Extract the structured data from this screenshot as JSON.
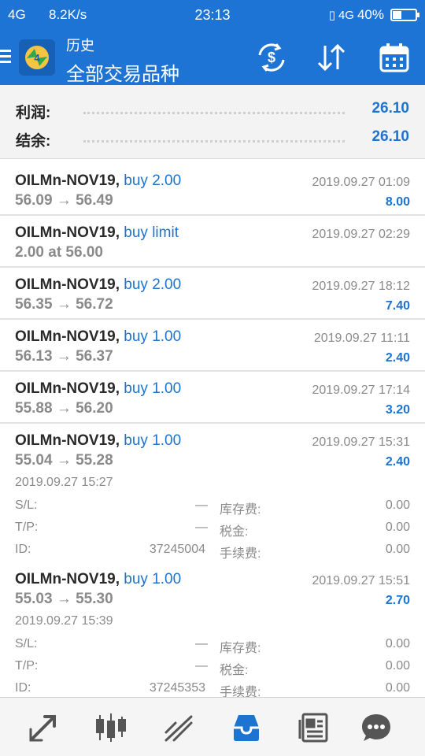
{
  "status_bar": {
    "network": "4G",
    "speed": "8.2K/s",
    "time": "23:13",
    "network2": "4G",
    "battery": "40%",
    "battery_level": 0.4
  },
  "header": {
    "subtitle": "历史",
    "title": "全部交易品种"
  },
  "summary": {
    "profit_label": "利润:",
    "profit_value": "26.10",
    "balance_label": "结余:",
    "balance_value": "26.10"
  },
  "deals": [
    {
      "symbol": "OILMn-NOV19,",
      "type": "buy 2.00",
      "prices": "56.09 → 56.49",
      "time": "2019.09.27 01:09",
      "profit": "8.00"
    },
    {
      "symbol": "OILMn-NOV19,",
      "type": "buy limit",
      "prices": "2.00 at 56.00",
      "time": "2019.09.27 02:29",
      "profit": ""
    },
    {
      "symbol": "OILMn-NOV19,",
      "type": "buy 2.00",
      "prices": "56.35 → 56.72",
      "time": "2019.09.27 18:12",
      "profit": "7.40"
    },
    {
      "symbol": "OILMn-NOV19,",
      "type": "buy 1.00",
      "prices": "56.13 → 56.37",
      "time": "2019.09.27 11:11",
      "profit": "2.40"
    },
    {
      "symbol": "OILMn-NOV19,",
      "type": "buy 1.00",
      "prices": "55.88 → 56.20",
      "time": "2019.09.27 17:14",
      "profit": "3.20"
    },
    {
      "symbol": "OILMn-NOV19,",
      "type": "buy 1.00",
      "prices": "55.04 → 55.28",
      "time": "2019.09.27 15:31",
      "profit": "2.40",
      "open_time": "2019.09.27 15:27",
      "sl_label": "S/L:",
      "sl": "—",
      "tp_label": "T/P:",
      "tp": "—",
      "id_label": "ID:",
      "id": "37245004",
      "swap_label": "库存费:",
      "swap": "0.00",
      "tax_label": "税金:",
      "tax": "0.00",
      "fee_label": "手续费:",
      "fee": "0.00"
    },
    {
      "symbol": "OILMn-NOV19,",
      "type": "buy 1.00",
      "prices": "55.03 → 55.30",
      "time": "2019.09.27 15:51",
      "profit": "2.70",
      "open_time": "2019.09.27 15:39",
      "sl_label": "S/L:",
      "sl": "—",
      "tp_label": "T/P:",
      "tp": "—",
      "id_label": "ID:",
      "id": "37245353",
      "swap_label": "库存费:",
      "swap": "0.00",
      "tax_label": "税金:",
      "tax": "0.00",
      "fee_label": "手续费:",
      "fee": "0.00"
    }
  ],
  "toolbar": {
    "icons": [
      "trade-icon",
      "quotes-chart-icon",
      "chart-icon",
      "history-icon",
      "news-icon",
      "chat-icon"
    ]
  },
  "colors": {
    "accent": "#1e74d4",
    "value_blue": "#1d73d0",
    "muted": "#8a8a8a"
  }
}
